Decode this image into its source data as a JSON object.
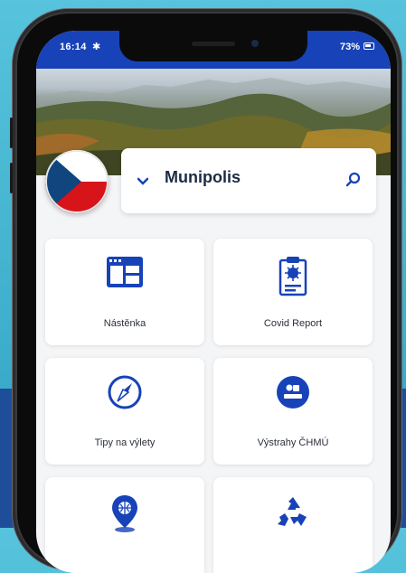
{
  "status_bar": {
    "time": "16:14",
    "battery": "73%"
  },
  "header": {
    "municipality": "Munipolis"
  },
  "tiles": [
    {
      "label": "Nástěnka",
      "icon": "bulletin-board-icon"
    },
    {
      "label": "Covid Report",
      "icon": "clipboard-virus-icon"
    },
    {
      "label": "Tipy na výlety",
      "icon": "compass-icon"
    },
    {
      "label": "Výstrahy ČHMÚ",
      "icon": "chmu-logo-icon"
    },
    {
      "label": "",
      "icon": "map-pin-globe-icon"
    },
    {
      "label": "",
      "icon": "recycle-icon"
    }
  ],
  "colors": {
    "brand": "#1742b8",
    "background": "#57c3dc"
  }
}
